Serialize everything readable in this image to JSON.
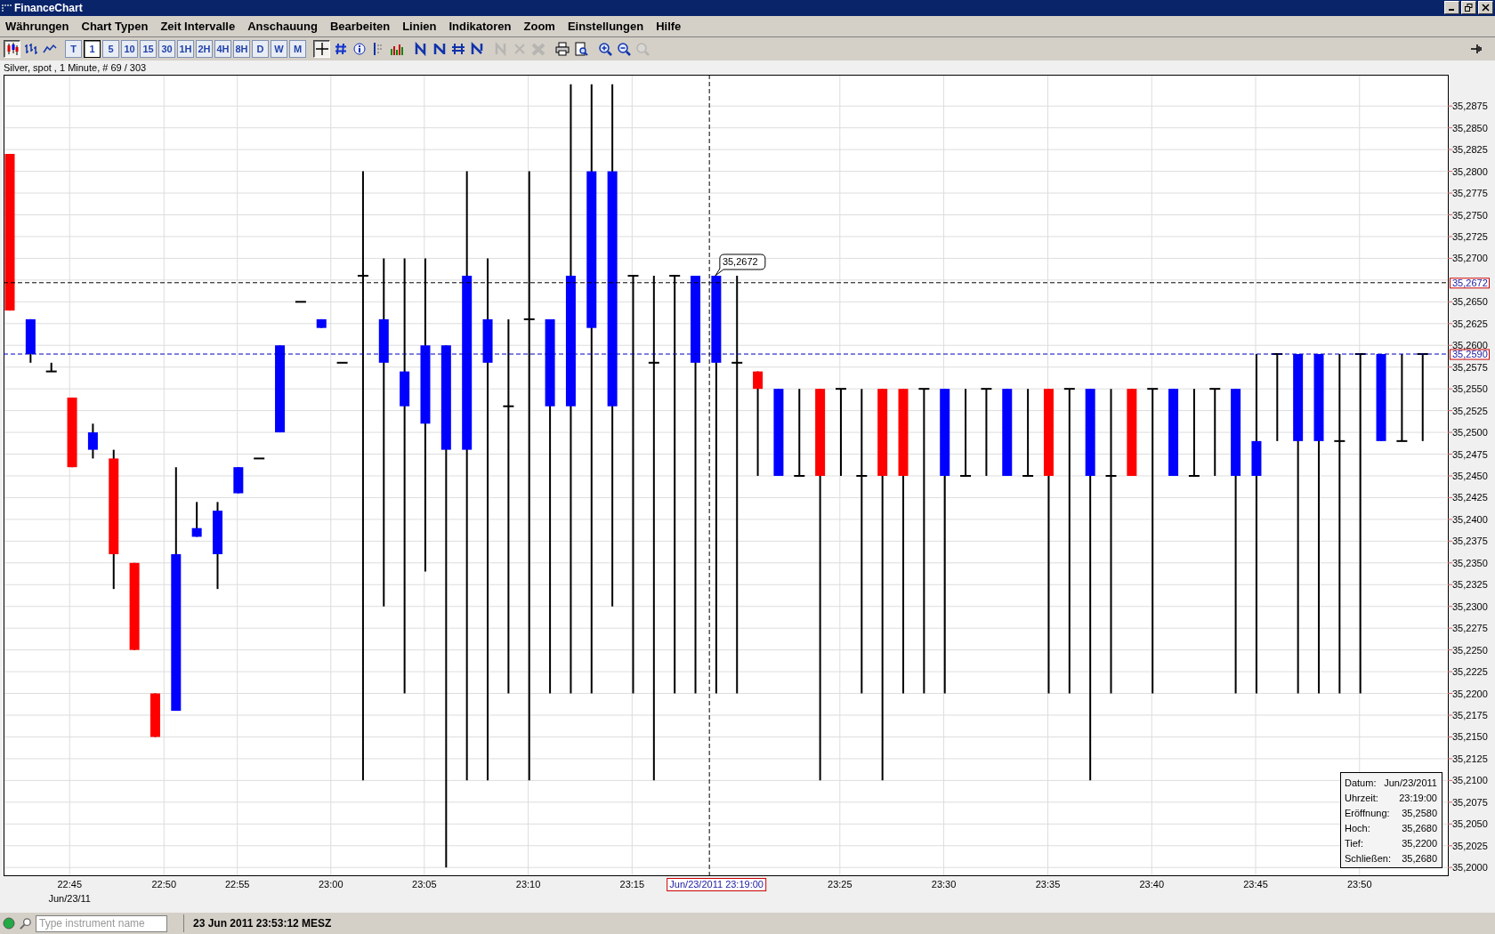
{
  "window": {
    "title": "FinanceChart"
  },
  "menu": [
    "Währungen",
    "Chart Typen",
    "Zeit Intervalle",
    "Anschauung",
    "Bearbeiten",
    "Linien",
    "Indikatoren",
    "Zoom",
    "Einstellungen",
    "Hilfe"
  ],
  "toolbar": {
    "groups": [
      [
        {
          "kind": "icon",
          "selected": true,
          "disabled": false
        },
        {
          "kind": "icon",
          "selected": false,
          "disabled": false
        },
        {
          "kind": "icon",
          "selected": false,
          "disabled": false
        }
      ],
      [
        {
          "kind": "text",
          "label": "T",
          "selected": false
        },
        {
          "kind": "text",
          "label": "1",
          "selected": true
        },
        {
          "kind": "text",
          "label": "5",
          "selected": false
        },
        {
          "kind": "text",
          "label": "10",
          "selected": false
        },
        {
          "kind": "text",
          "label": "15",
          "selected": false
        },
        {
          "kind": "text",
          "label": "30",
          "selected": false
        },
        {
          "kind": "text",
          "label": "1H",
          "selected": false
        },
        {
          "kind": "text",
          "label": "2H",
          "selected": false
        },
        {
          "kind": "text",
          "label": "4H",
          "selected": false
        },
        {
          "kind": "text",
          "label": "8H",
          "selected": false
        },
        {
          "kind": "text",
          "label": "D",
          "selected": false
        },
        {
          "kind": "text",
          "label": "W",
          "selected": false
        },
        {
          "kind": "text",
          "label": "M",
          "selected": false
        }
      ],
      [
        {
          "kind": "icon",
          "selected": true,
          "disabled": false
        },
        {
          "kind": "icon",
          "selected": false,
          "disabled": false
        },
        {
          "kind": "icon",
          "selected": false,
          "disabled": false
        },
        {
          "kind": "icon",
          "selected": false,
          "disabled": false
        },
        {
          "kind": "icon",
          "selected": false,
          "disabled": false
        }
      ],
      [
        {
          "kind": "icon",
          "selected": false,
          "disabled": false
        },
        {
          "kind": "icon",
          "selected": false,
          "disabled": false
        },
        {
          "kind": "icon",
          "selected": false,
          "disabled": false
        },
        {
          "kind": "icon",
          "selected": false,
          "disabled": false
        }
      ],
      [
        {
          "kind": "icon",
          "selected": false,
          "disabled": true
        },
        {
          "kind": "icon",
          "selected": false,
          "disabled": true
        },
        {
          "kind": "icon",
          "selected": false,
          "disabled": true
        }
      ],
      [
        {
          "kind": "icon",
          "selected": false,
          "disabled": false
        },
        {
          "kind": "icon",
          "selected": false,
          "disabled": false
        }
      ],
      [
        {
          "kind": "icon",
          "selected": false,
          "disabled": false
        },
        {
          "kind": "icon",
          "selected": false,
          "disabled": false
        },
        {
          "kind": "icon",
          "selected": false,
          "disabled": true
        }
      ]
    ],
    "right": [
      {
        "kind": "icon",
        "selected": false,
        "disabled": false
      }
    ]
  },
  "chart": {
    "info_line": "Silver, spot , 1 Minute, # 69 / 303",
    "y_axis_labels": [
      "35,2875",
      "35,2850",
      "35,2825",
      "35,2800",
      "35,2775",
      "35,2750",
      "35,2725",
      "35,2700",
      "35,2650",
      "35,2625",
      "35,2600",
      "35,2575",
      "35,2550",
      "35,2525",
      "35,2500",
      "35,2475",
      "35,2450",
      "35,2425",
      "35,2400",
      "35,2375",
      "35,2350",
      "35,2325",
      "35,2300",
      "35,2275",
      "35,2250",
      "35,2225",
      "35,2200",
      "35,2175",
      "35,2150",
      "35,2125",
      "35,2100",
      "35,2075",
      "35,2050",
      "35,2025",
      "35,2000"
    ],
    "x_axis_labels": [
      "22:45",
      "22:50",
      "22:55",
      "23:00",
      "23:05",
      "23:10",
      "23:15",
      "23:25",
      "23:30",
      "23:35",
      "23:40",
      "23:45",
      "23:50"
    ],
    "date_label": "Jun/23/11",
    "price_markers": [
      "35,2672",
      "35,2590"
    ],
    "cursor_label": "Jun/23/2011 23:19:00",
    "callout": "35,2672",
    "info_box": [
      {
        "label": "Datum:",
        "value": "Jun/23/2011"
      },
      {
        "label": "Uhrzeit:",
        "value": "23:19:00"
      },
      {
        "label": "Eröffnung:",
        "value": "35,2580"
      },
      {
        "label": "Hoch:",
        "value": "35,2680"
      },
      {
        "label": "Tief:",
        "value": "35,2200"
      },
      {
        "label": "Schließen:",
        "value": "35,2680"
      }
    ]
  },
  "status_bar": {
    "connected": true,
    "search": {
      "placeholder": "Type instrument name"
    },
    "time": "23 Jun 2011 23:53:12 MESZ"
  }
}
